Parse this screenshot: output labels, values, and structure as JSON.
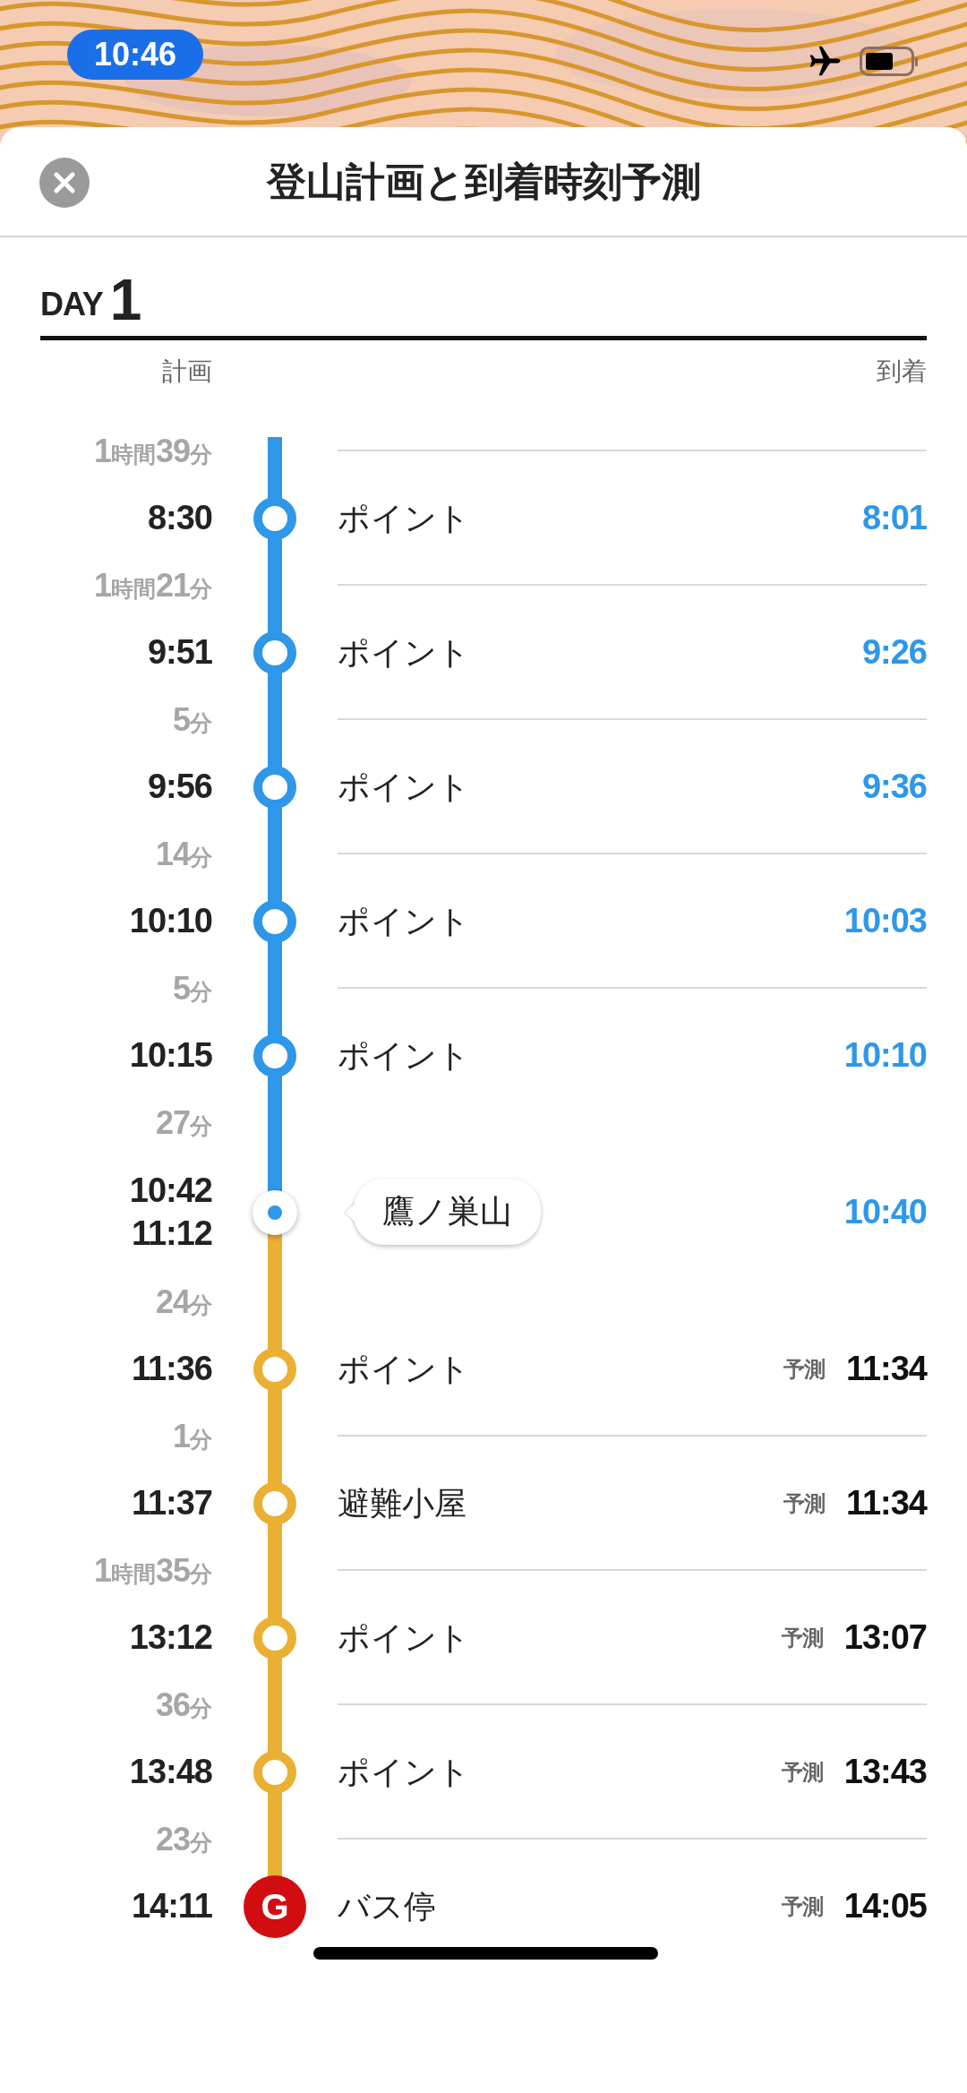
{
  "status_bar": {
    "time": "10:46"
  },
  "header": {
    "title": "登山計画と到着時刻予測"
  },
  "day": {
    "label": "DAY",
    "number": "1"
  },
  "columns": {
    "plan": "計画",
    "arrival": "到着"
  },
  "stops": [
    {
      "leg_time": "1時間39分",
      "plan_times": [
        "8:30"
      ],
      "name": "ポイント",
      "arrival": "8:01",
      "kind": "point",
      "passed": true
    },
    {
      "leg_time": "1時間21分",
      "plan_times": [
        "9:51"
      ],
      "name": "ポイント",
      "arrival": "9:26",
      "kind": "point",
      "passed": true
    },
    {
      "leg_time": "5分",
      "plan_times": [
        "9:56"
      ],
      "name": "ポイント",
      "arrival": "9:36",
      "kind": "point",
      "passed": true
    },
    {
      "leg_time": "14分",
      "plan_times": [
        "10:10"
      ],
      "name": "ポイント",
      "arrival": "10:03",
      "kind": "point",
      "passed": true
    },
    {
      "leg_time": "5分",
      "plan_times": [
        "10:15"
      ],
      "name": "ポイント",
      "arrival": "10:10",
      "kind": "point",
      "passed": true
    },
    {
      "leg_time": "27分",
      "plan_times": [
        "10:42",
        "11:12"
      ],
      "name": "鷹ノ巣山",
      "arrival": "10:40",
      "kind": "summit",
      "passed": true
    },
    {
      "leg_time": "24分",
      "plan_times": [
        "11:36"
      ],
      "name": "ポイント",
      "predicted_label": "予測",
      "arrival": "11:34",
      "kind": "point",
      "passed": false
    },
    {
      "leg_time": "1分",
      "plan_times": [
        "11:37"
      ],
      "name": "避難小屋",
      "predicted_label": "予測",
      "arrival": "11:34",
      "kind": "point",
      "passed": false
    },
    {
      "leg_time": "1時間35分",
      "plan_times": [
        "13:12"
      ],
      "name": "ポイント",
      "predicted_label": "予測",
      "arrival": "13:07",
      "kind": "point",
      "passed": false
    },
    {
      "leg_time": "36分",
      "plan_times": [
        "13:48"
      ],
      "name": "ポイント",
      "predicted_label": "予測",
      "arrival": "13:43",
      "kind": "point",
      "passed": false
    },
    {
      "leg_time": "23分",
      "plan_times": [
        "14:11"
      ],
      "name": "バス停",
      "predicted_label": "予測",
      "arrival": "14:05",
      "kind": "goal",
      "marker_label": "G",
      "passed": false
    }
  ]
}
